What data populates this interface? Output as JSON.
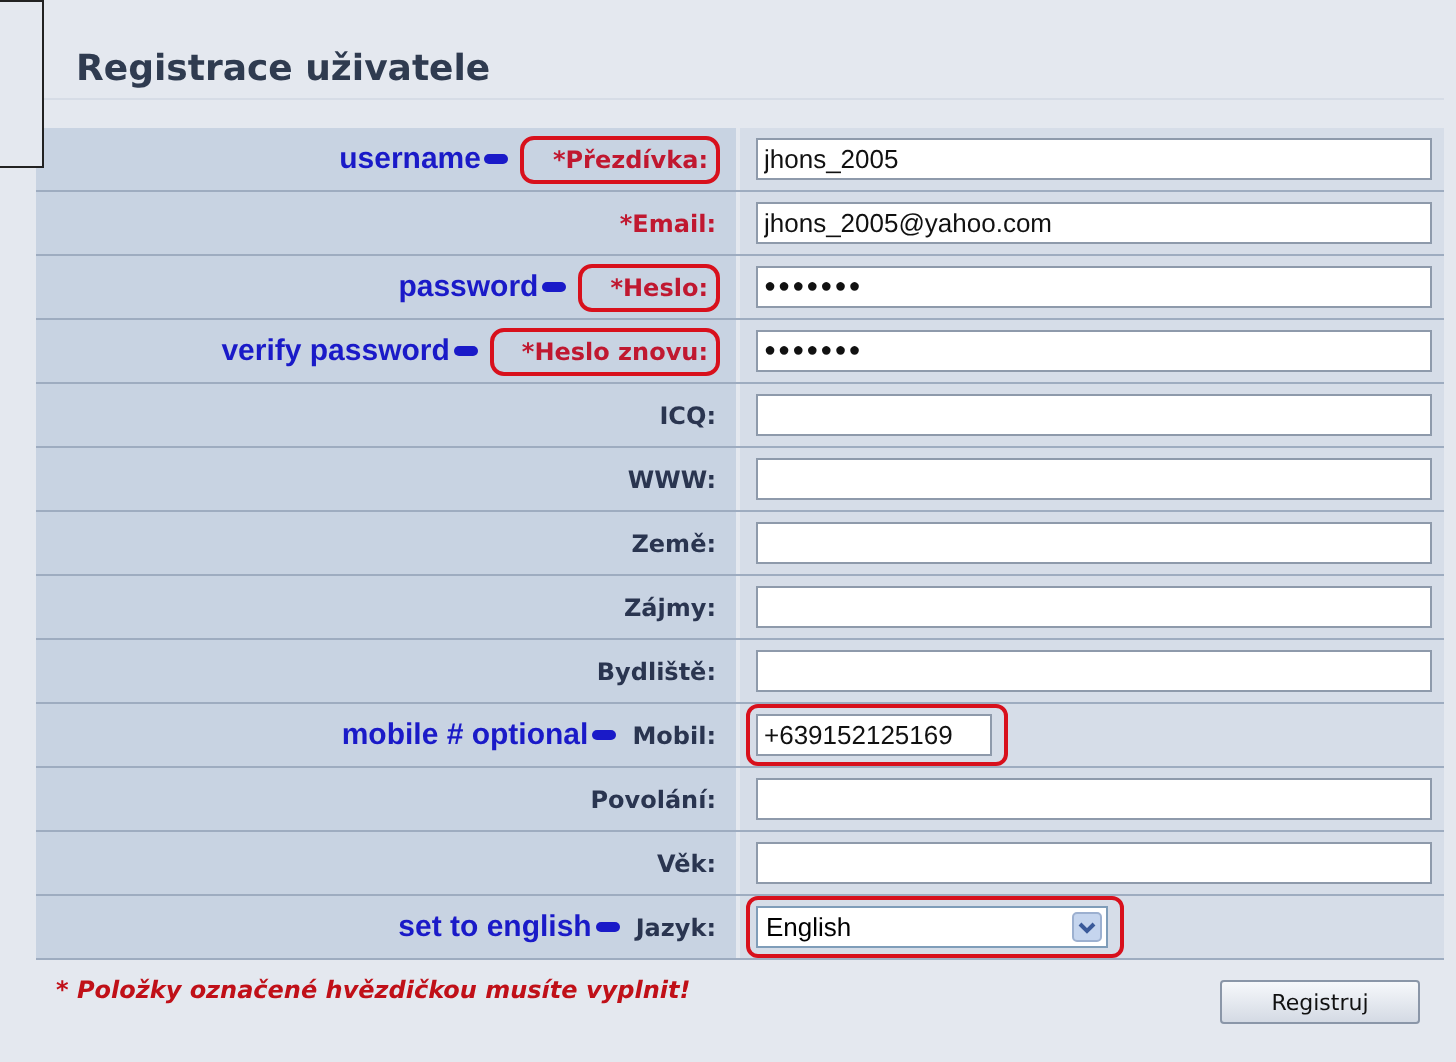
{
  "title": "Registrace uživatele",
  "fields": [
    {
      "label": "*Přezdívka:",
      "required": true,
      "kind": "text",
      "value": "jhons_2005",
      "annotation": "username",
      "label_circled": true,
      "field_circled": false
    },
    {
      "label": "*Email:",
      "required": true,
      "kind": "text",
      "value": "jhons_2005@yahoo.com",
      "label_circled": false,
      "field_circled": false
    },
    {
      "label": "*Heslo:",
      "required": true,
      "kind": "password",
      "value": "●●●●●●●",
      "annotation": "password",
      "label_circled": true,
      "field_circled": false
    },
    {
      "label": "*Heslo znovu:",
      "required": true,
      "kind": "password",
      "value": "●●●●●●●",
      "annotation": "verify password",
      "label_circled": true,
      "field_circled": false
    },
    {
      "label": "ICQ:",
      "required": false,
      "kind": "text",
      "label_circled": false,
      "field_circled": false
    },
    {
      "label": "WWW:",
      "required": false,
      "kind": "text",
      "label_circled": false,
      "field_circled": false
    },
    {
      "label": "Země:",
      "required": false,
      "kind": "text",
      "label_circled": false,
      "field_circled": false
    },
    {
      "label": "Zájmy:",
      "required": false,
      "kind": "text",
      "label_circled": false,
      "field_circled": false
    },
    {
      "label": "Bydliště:",
      "required": false,
      "kind": "text",
      "label_circled": false,
      "field_circled": false
    },
    {
      "label": "Mobil:",
      "required": false,
      "kind": "text",
      "value": "+639152125169",
      "annotation": "mobile # optional",
      "label_circled": false,
      "field_circled": true
    },
    {
      "label": "Povolání:",
      "required": false,
      "kind": "text",
      "label_circled": false,
      "field_circled": false
    },
    {
      "label": "Věk:",
      "required": false,
      "kind": "text",
      "label_circled": false,
      "field_circled": false
    },
    {
      "label": "Jazyk:",
      "required": false,
      "kind": "select",
      "value": "English",
      "annotation": "set to english",
      "label_circled": false,
      "field_circled": true
    }
  ],
  "note": "* Položky označené hvězdičkou musíte vyplnit!",
  "submit": "Registruj"
}
